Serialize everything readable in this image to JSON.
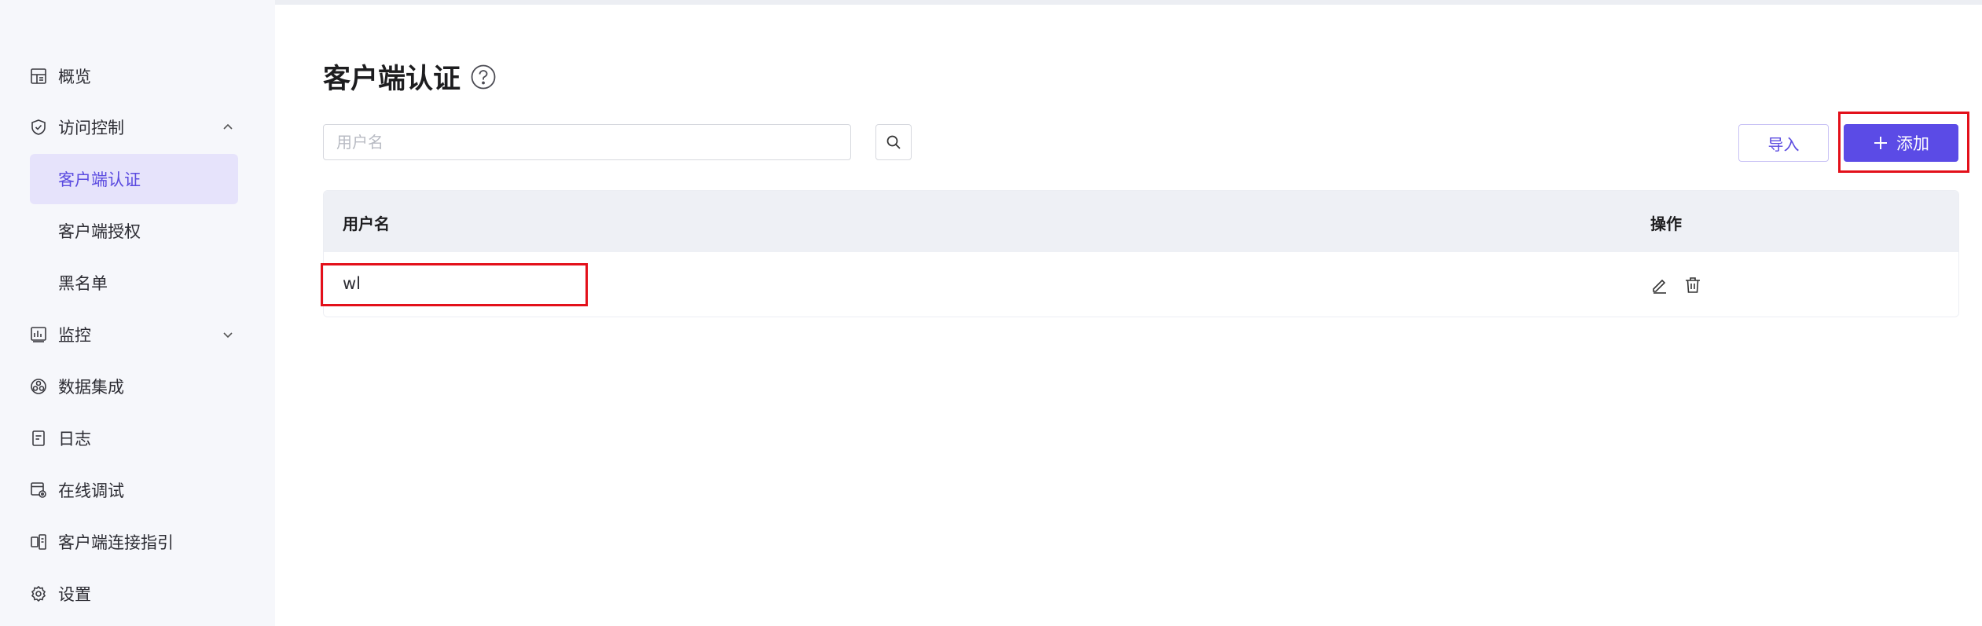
{
  "sidebar": {
    "items": [
      {
        "label": "概览",
        "icon": "dashboard-icon"
      },
      {
        "label": "访问控制",
        "icon": "shield-check-icon",
        "expanded": true
      },
      {
        "label": "客户端认证",
        "active": true
      },
      {
        "label": "客户端授权"
      },
      {
        "label": "黑名单"
      },
      {
        "label": "监控",
        "icon": "chart-icon",
        "expanded": false
      },
      {
        "label": "数据集成",
        "icon": "integration-icon"
      },
      {
        "label": "日志",
        "icon": "log-icon"
      },
      {
        "label": "在线调试",
        "icon": "debug-icon"
      },
      {
        "label": "客户端连接指引",
        "icon": "guide-icon"
      },
      {
        "label": "设置",
        "icon": "gear-icon"
      }
    ]
  },
  "page": {
    "title": "客户端认证"
  },
  "search": {
    "placeholder": "用户名"
  },
  "toolbar": {
    "import_label": "导入",
    "add_label": "添加"
  },
  "table": {
    "columns": [
      "用户名",
      "操作"
    ],
    "rows": [
      {
        "username": "wl"
      }
    ]
  },
  "colors": {
    "accent": "#5b4be6",
    "active_bg": "#e6e3fb",
    "highlight_box": "#e3101a"
  }
}
